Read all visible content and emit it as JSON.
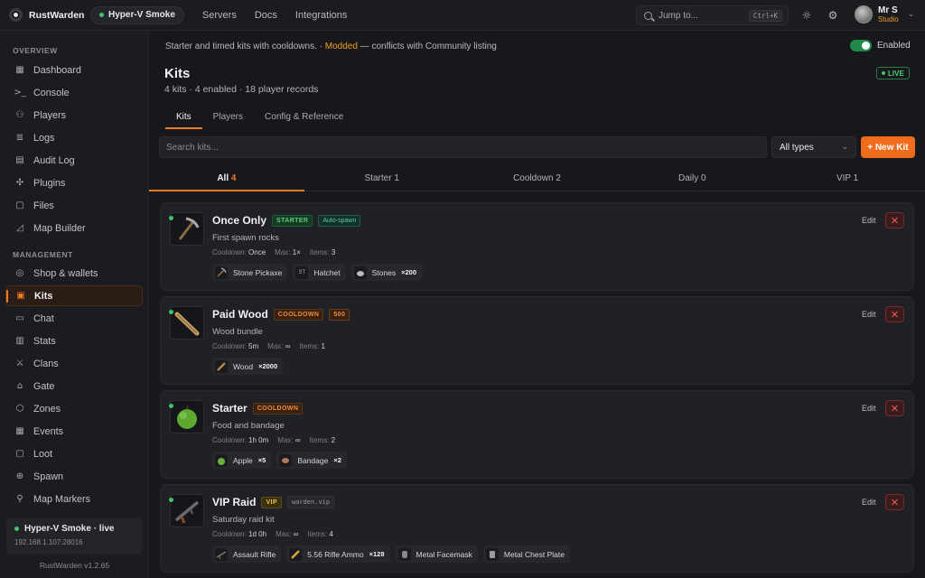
{
  "app": {
    "name": "RustWarden",
    "version": "RustWarden v1.2.65"
  },
  "topbar": {
    "server": "Hyper-V Smoke",
    "nav": [
      "Servers",
      "Docs",
      "Integrations"
    ],
    "search_placeholder": "Jump to...",
    "shortcut": "Ctrl+K",
    "user": {
      "name": "Mr S",
      "role": "Studio"
    }
  },
  "sidebar": {
    "overview_label": "OVERVIEW",
    "overview": [
      {
        "label": "Dashboard",
        "icon": "grid-icon"
      },
      {
        "label": "Console",
        "icon": "terminal-icon"
      },
      {
        "label": "Players",
        "icon": "users-icon"
      },
      {
        "label": "Logs",
        "icon": "list-icon"
      },
      {
        "label": "Audit Log",
        "icon": "clipboard-icon"
      },
      {
        "label": "Plugins",
        "icon": "puzzle-icon"
      },
      {
        "label": "Files",
        "icon": "file-icon"
      },
      {
        "label": "Map Builder",
        "icon": "map-icon"
      }
    ],
    "management_label": "MANAGEMENT",
    "management": [
      {
        "label": "Shop & wallets",
        "icon": "coin-icon"
      },
      {
        "label": "Kits",
        "icon": "kit-icon"
      },
      {
        "label": "Chat",
        "icon": "chat-icon"
      },
      {
        "label": "Stats",
        "icon": "bar-chart-icon"
      },
      {
        "label": "Clans",
        "icon": "clan-icon"
      },
      {
        "label": "Gate",
        "icon": "lock-icon"
      },
      {
        "label": "Zones",
        "icon": "zone-icon"
      },
      {
        "label": "Events",
        "icon": "calendar-icon"
      },
      {
        "label": "Loot",
        "icon": "box-icon"
      },
      {
        "label": "Spawn",
        "icon": "crosshair-icon"
      },
      {
        "label": "Map Markers",
        "icon": "pin-icon"
      }
    ],
    "active": "Kits",
    "server_box": {
      "name": "Hyper-V Smoke · live",
      "ip": "192.168.1.107:28016"
    }
  },
  "main": {
    "desc_prefix": "Starter and timed kits with cooldowns. · ",
    "desc_modded": "Modded",
    "desc_suffix": " — conflicts with Community listing",
    "toggle_label": "Enabled",
    "title": "Kits",
    "subtitle": "4 kits · 4 enabled · 18 player records",
    "live": "LIVE",
    "tabs": [
      "Kits",
      "Players",
      "Config & Reference"
    ],
    "search_placeholder": "Search kits...",
    "type_select": "All types",
    "new_kit": "+ New Kit",
    "filters": [
      {
        "label": "All",
        "count": "4"
      },
      {
        "label": "Starter",
        "count": "1"
      },
      {
        "label": "Cooldown",
        "count": "2"
      },
      {
        "label": "Daily",
        "count": "0"
      },
      {
        "label": "VIP",
        "count": "1"
      }
    ],
    "edit_label": "Edit",
    "kits": [
      {
        "name": "Once Only",
        "badges": [
          {
            "text": "STARTER",
            "cls": "b-starter"
          },
          {
            "text": "Auto-spawn",
            "cls": "b-auto"
          }
        ],
        "desc": "First spawn rocks",
        "cooldown": "Once",
        "max": "1×",
        "items_count": "3",
        "items": [
          {
            "name": "Stone Pickaxe",
            "qty": "",
            "icon": "pickaxe-icon"
          },
          {
            "name": "Hatchet",
            "qty": "",
            "icon": "hatchet-icon"
          },
          {
            "name": "Stones",
            "qty": "×200",
            "icon": "stones-icon"
          }
        ]
      },
      {
        "name": "Paid Wood",
        "badges": [
          {
            "text": "COOLDOWN",
            "cls": "b-cool"
          },
          {
            "text": "500",
            "cls": "b-500"
          }
        ],
        "desc": "Wood bundle",
        "cooldown": "5m",
        "max": "∞",
        "items_count": "1",
        "items": [
          {
            "name": "Wood",
            "qty": "×2000",
            "icon": "wood-icon"
          }
        ]
      },
      {
        "name": "Starter",
        "badges": [
          {
            "text": "COOLDOWN",
            "cls": "b-cool"
          }
        ],
        "desc": "Food and bandage",
        "cooldown": "1h 0m",
        "max": "∞",
        "items_count": "2",
        "items": [
          {
            "name": "Apple",
            "qty": "×5",
            "icon": "apple-icon"
          },
          {
            "name": "Bandage",
            "qty": "×2",
            "icon": "bandage-icon"
          }
        ]
      },
      {
        "name": "VIP Raid",
        "badges": [
          {
            "text": "VIP",
            "cls": "b-vip"
          },
          {
            "text": "warden.vip",
            "cls": "b-mono"
          }
        ],
        "desc": "Saturday raid kit",
        "cooldown": "1d 0h",
        "max": "∞",
        "items_count": "4",
        "items": [
          {
            "name": "Assault Rifle",
            "qty": "",
            "icon": "rifle-icon"
          },
          {
            "name": "5.56 Rifle Ammo",
            "qty": "×128",
            "icon": "ammo-icon"
          },
          {
            "name": "Metal Facemask",
            "qty": "",
            "icon": "facemask-icon"
          },
          {
            "name": "Metal Chest Plate",
            "qty": "",
            "icon": "chestplate-icon"
          }
        ]
      }
    ],
    "meta_labels": {
      "cooldown": "Cooldown:",
      "max": "Max:",
      "items": "Items:"
    }
  }
}
